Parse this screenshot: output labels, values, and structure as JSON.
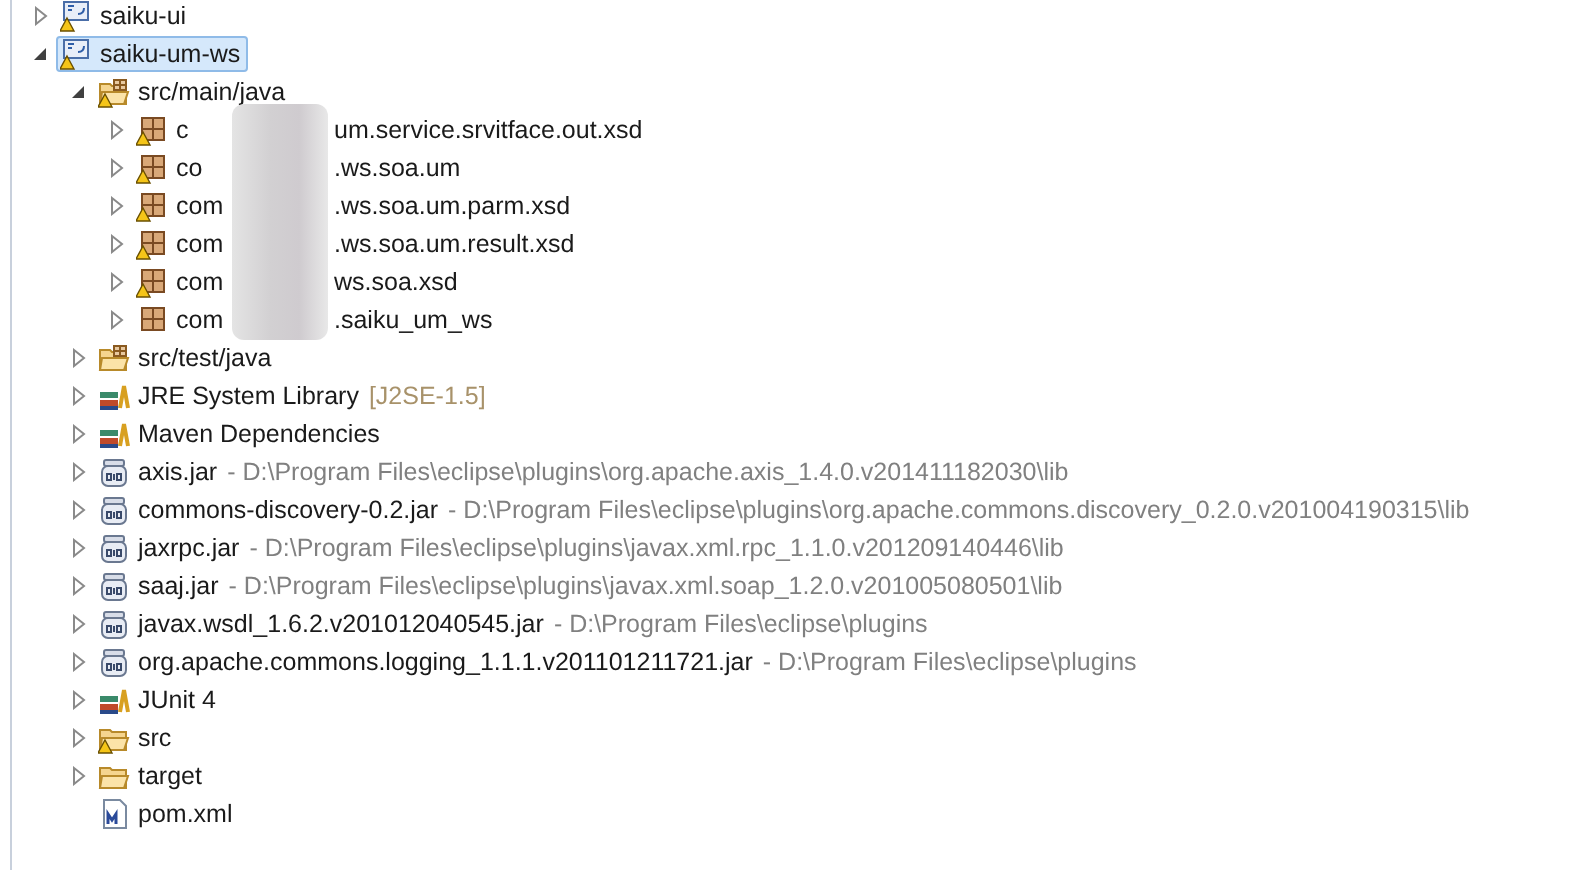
{
  "tree": [
    {
      "label": "saiku-ui",
      "kind": "project",
      "warning": true,
      "expanded": false,
      "selected": false
    },
    {
      "label": "saiku-um-ws",
      "kind": "project",
      "warning": true,
      "expanded": true,
      "selected": true,
      "children": [
        {
          "label": "src/main/java",
          "kind": "source-folder",
          "warning": true,
          "expanded": true,
          "selected": false,
          "children": [
            {
              "label": "c",
              "label_after_redaction": "um.service.srvitface.out.xsd",
              "kind": "package",
              "warning": true,
              "expanded": false,
              "selected": false
            },
            {
              "label": "co",
              "label_after_redaction": ".ws.soa.um",
              "kind": "package",
              "warning": true,
              "expanded": false,
              "selected": false
            },
            {
              "label": "com",
              "label_after_redaction": ".ws.soa.um.parm.xsd",
              "kind": "package",
              "warning": true,
              "expanded": false,
              "selected": false
            },
            {
              "label": "com",
              "label_after_redaction": ".ws.soa.um.result.xsd",
              "kind": "package",
              "warning": true,
              "expanded": false,
              "selected": false
            },
            {
              "label": "com",
              "label_after_redaction": "ws.soa.xsd",
              "kind": "package",
              "warning": true,
              "expanded": false,
              "selected": false
            },
            {
              "label": "com",
              "label_after_redaction": ".saiku_um_ws",
              "kind": "package",
              "warning": false,
              "expanded": false,
              "selected": false
            }
          ]
        },
        {
          "label": "src/test/java",
          "kind": "source-folder",
          "warning": false,
          "expanded": false,
          "selected": false
        },
        {
          "label": "JRE System Library",
          "decoration": {
            "text": "[J2SE-1.5]",
            "kind": "version"
          },
          "kind": "library",
          "expanded": false,
          "selected": false
        },
        {
          "label": "Maven Dependencies",
          "kind": "library",
          "expanded": false,
          "selected": false
        },
        {
          "label": "axis.jar",
          "decoration": {
            "text": "- D:\\Program Files\\eclipse\\plugins\\org.apache.axis_1.4.0.v201411182030\\lib",
            "kind": "path"
          },
          "kind": "jar",
          "expanded": false,
          "selected": false
        },
        {
          "label": "commons-discovery-0.2.jar",
          "decoration": {
            "text": "- D:\\Program Files\\eclipse\\plugins\\org.apache.commons.discovery_0.2.0.v201004190315\\lib",
            "kind": "path"
          },
          "kind": "jar",
          "expanded": false,
          "selected": false
        },
        {
          "label": "jaxrpc.jar",
          "decoration": {
            "text": "- D:\\Program Files\\eclipse\\plugins\\javax.xml.rpc_1.1.0.v201209140446\\lib",
            "kind": "path"
          },
          "kind": "jar",
          "expanded": false,
          "selected": false
        },
        {
          "label": "saaj.jar",
          "decoration": {
            "text": "- D:\\Program Files\\eclipse\\plugins\\javax.xml.soap_1.2.0.v201005080501\\lib",
            "kind": "path"
          },
          "kind": "jar",
          "expanded": false,
          "selected": false
        },
        {
          "label": "javax.wsdl_1.6.2.v201012040545.jar",
          "decoration": {
            "text": "- D:\\Program Files\\eclipse\\plugins",
            "kind": "path"
          },
          "kind": "jar",
          "expanded": false,
          "selected": false
        },
        {
          "label": "org.apache.commons.logging_1.1.1.v201101211721.jar",
          "decoration": {
            "text": "- D:\\Program Files\\eclipse\\plugins",
            "kind": "path"
          },
          "kind": "jar",
          "expanded": false,
          "selected": false
        },
        {
          "label": "JUnit 4",
          "kind": "library",
          "expanded": false,
          "selected": false
        },
        {
          "label": "src",
          "kind": "folder",
          "warning": true,
          "expanded": false,
          "selected": false
        },
        {
          "label": "target",
          "kind": "folder",
          "warning": false,
          "expanded": false,
          "selected": false
        },
        {
          "label": "pom.xml",
          "kind": "maven-file",
          "selected": false
        }
      ]
    }
  ]
}
